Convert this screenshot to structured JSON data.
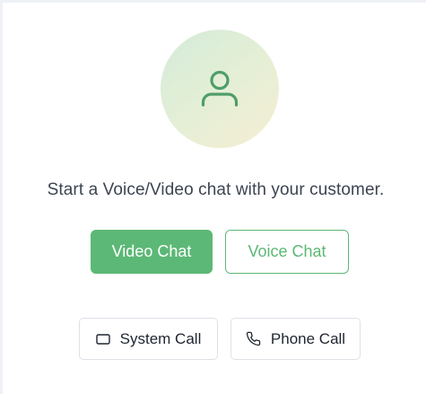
{
  "message": "Start a Voice/Video chat with your customer.",
  "buttons": {
    "video_chat": "Video Chat",
    "voice_chat": "Voice Chat",
    "system_call": "System Call",
    "phone_call": "Phone Call"
  },
  "icons": {
    "avatar": "user-icon",
    "system_call": "monitor-icon",
    "phone_call": "phone-icon"
  },
  "colors": {
    "accent": "#5cb876",
    "avatar_icon": "#4f9e69",
    "text": "#3d4452"
  }
}
